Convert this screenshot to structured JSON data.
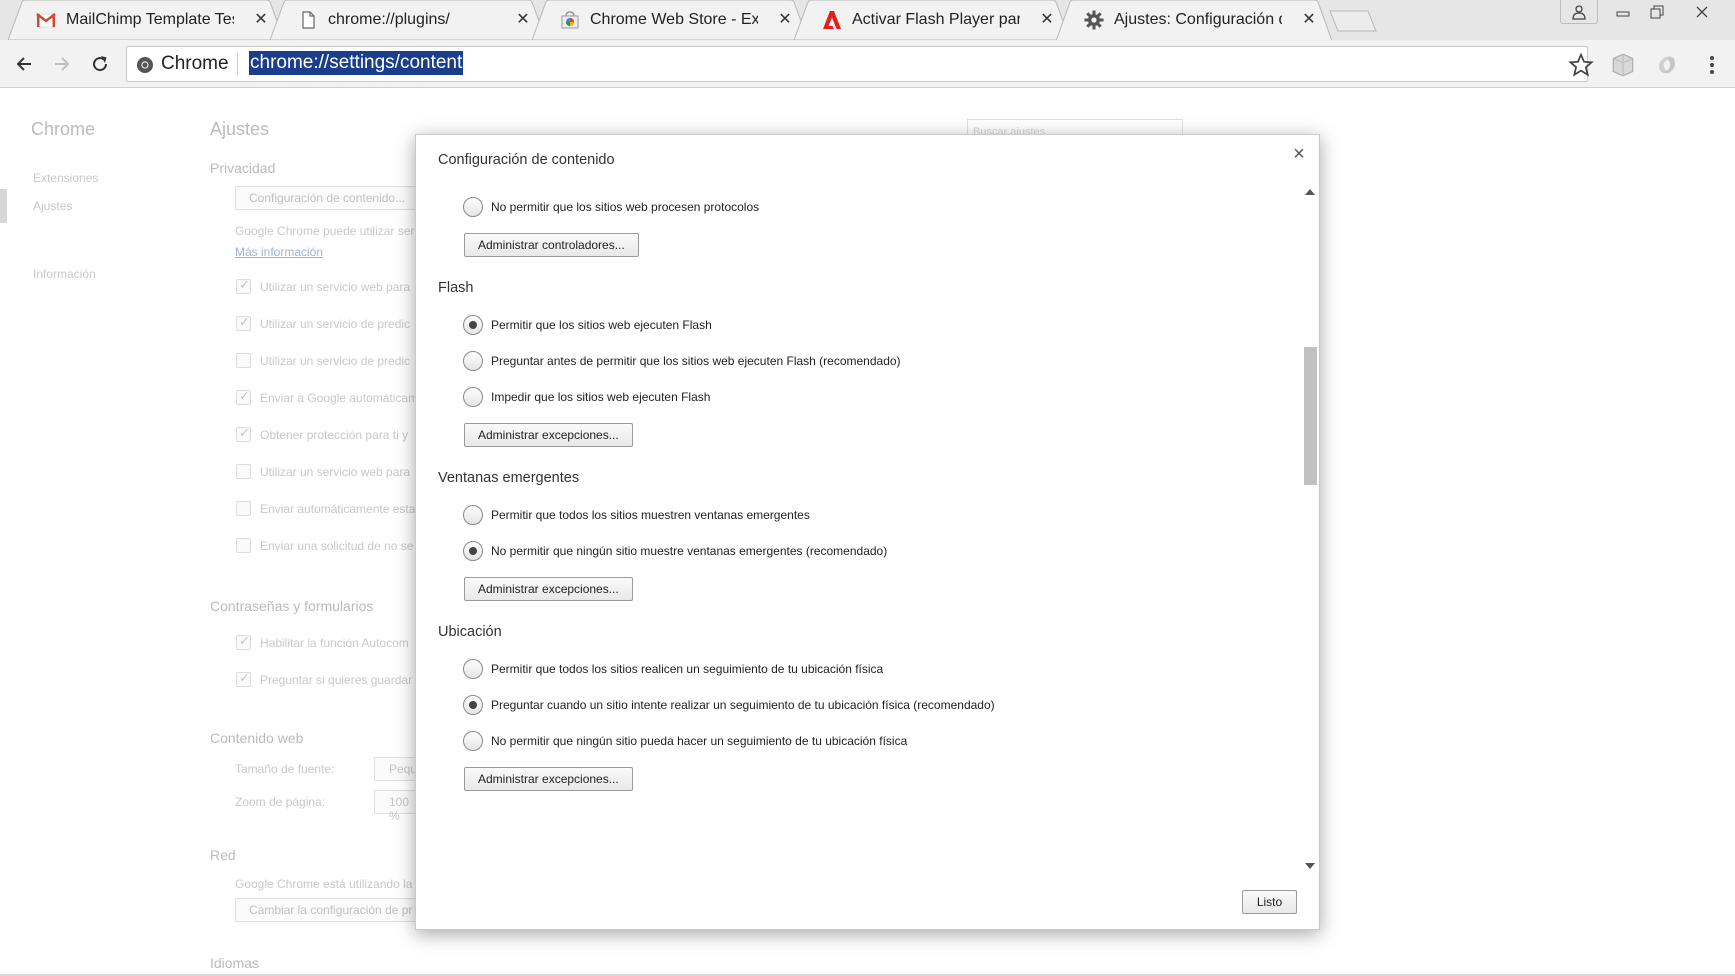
{
  "tabs": [
    {
      "title": "MailChimp Template Test -",
      "icon": "gmail-icon"
    },
    {
      "title": "chrome://plugins/",
      "icon": "page-icon"
    },
    {
      "title": "Chrome Web Store - Exten:",
      "icon": "webstore-icon"
    },
    {
      "title": "Activar Flash Player para G",
      "icon": "adobe-icon"
    },
    {
      "title": "Ajustes: Configuración de c",
      "icon": "gear-icon",
      "active": true
    }
  ],
  "omnibox": {
    "scheme_label": "Chrome",
    "url": "chrome://settings/content"
  },
  "settings": {
    "sidebar": {
      "title": "Chrome",
      "extensions": "Extensiones",
      "settings": "Ajustes",
      "about": "Información"
    },
    "title": "Ajustes",
    "search_placeholder": "Buscar ajustes",
    "privacy": {
      "heading": "Privacidad",
      "content_button": "Configuración de contenido...",
      "desc": "Google Chrome puede utilizar ser",
      "more_info": "Más información",
      "checks": [
        {
          "label": "Utilizar un servicio web para",
          "checked": true
        },
        {
          "label": "Utilizar un servicio de predic",
          "checked": true
        },
        {
          "label": "Utilizar un servicio de predic",
          "checked": false
        },
        {
          "label": "Enviar a Google automáticam",
          "checked": true
        },
        {
          "label": "Obtener protección para ti y",
          "checked": true
        },
        {
          "label": "Utilizar un servicio web para",
          "checked": false
        },
        {
          "label": "Enviar automáticamente esta",
          "checked": false
        },
        {
          "label": "Enviar una solicitud de no se",
          "checked": false
        }
      ]
    },
    "passwords": {
      "heading": "Contraseñas y formularios",
      "checks": [
        {
          "label": "Habilitar la función Autocom",
          "checked": true
        },
        {
          "label": "Preguntar si quieres guardar",
          "checked": true
        }
      ]
    },
    "web_content": {
      "heading": "Contenido web",
      "font_size_label": "Tamaño de fuente:",
      "font_size_value": "Pequ",
      "zoom_label": "Zoom de página:",
      "zoom_value": "100 %"
    },
    "network": {
      "heading": "Red",
      "desc": "Google Chrome está utilizando la",
      "button": "Cambiar la configuración de pr"
    },
    "languages": {
      "heading": "Idiomas"
    }
  },
  "dialog": {
    "title": "Configuración de contenido",
    "close": "×",
    "protocol_radio": "No permitir que los sitios web procesen protocolos",
    "manage_handlers": "Administrar controladores...",
    "flash": {
      "heading": "Flash",
      "options": [
        {
          "label": "Permitir que los sitios web ejecuten Flash",
          "selected": true
        },
        {
          "label": "Preguntar antes de permitir que los sitios web ejecuten Flash (recomendado)",
          "selected": false
        },
        {
          "label": "Impedir que los sitios web ejecuten Flash",
          "selected": false
        }
      ],
      "manage": "Administrar excepciones..."
    },
    "popups": {
      "heading": "Ventanas emergentes",
      "options": [
        {
          "label": "Permitir que todos los sitios muestren ventanas emergentes",
          "selected": false
        },
        {
          "label": "No permitir que ningún sitio muestre ventanas emergentes (recomendado)",
          "selected": true
        }
      ],
      "manage": "Administrar excepciones..."
    },
    "location": {
      "heading": "Ubicación",
      "options": [
        {
          "label": "Permitir que todos los sitios realicen un seguimiento de tu ubicación física",
          "selected": false
        },
        {
          "label": "Preguntar cuando un sitio intente realizar un seguimiento de tu ubicación física (recomendado)",
          "selected": true
        },
        {
          "label": "No permitir que ningún sitio pueda hacer un seguimiento de tu ubicación física",
          "selected": false
        }
      ],
      "manage": "Administrar excepciones..."
    },
    "done": "Listo"
  }
}
